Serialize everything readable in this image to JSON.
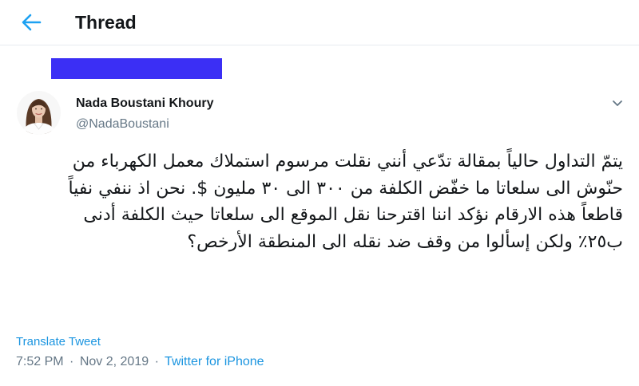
{
  "header": {
    "title": "Thread",
    "back_icon": "arrow-left-icon",
    "accent_color": "#1da1f2"
  },
  "tweet": {
    "display_name": "Nada Boustani Khoury",
    "handle": "@NadaBoustani",
    "text": "يتمّ التداول حالياً بمقالة تدّعي أنني نقلت مرسوم استملاك معمل الكهرباء من حنّوش الى سلعاتا ما خفّض الكلفة من ٣٠٠ الى ٣٠ مليون $. نحن اذ ننفي نفياً قاطعاً هذه الارقام نؤكد اننا اقترحنا نقل الموقع الى سلعاتا حيث الكلفة أدنى ب٢٥٪ ولكن إسألوا من وقف ضد نقله الى المنطقة الأرخص؟",
    "translate_label": "Translate Tweet",
    "time": "7:52 PM",
    "separator": "·",
    "date": "Nov 2, 2019",
    "source": "Twitter for iPhone",
    "caret_icon": "chevron-down-icon",
    "redaction_color": "#3b2ff5"
  }
}
